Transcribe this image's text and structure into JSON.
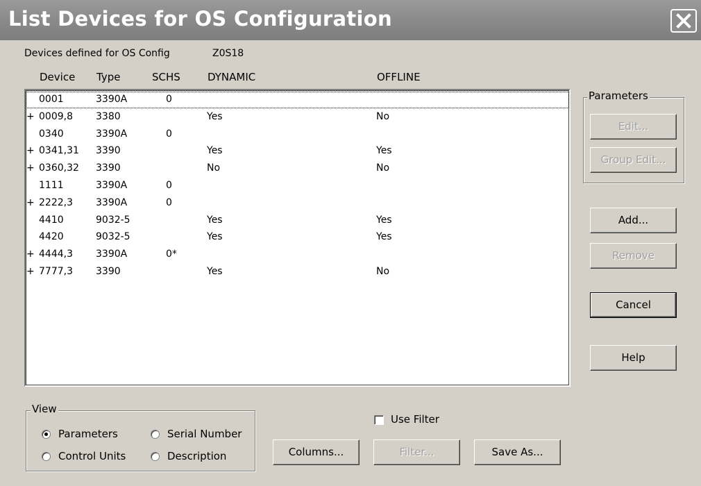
{
  "window": {
    "title": "List Devices for OS Configuration"
  },
  "header": {
    "label": "Devices defined for OS Config",
    "config_id": "Z0S18"
  },
  "columns": [
    "Device",
    "Type",
    "SCHS",
    "DYNAMIC",
    "OFFLINE"
  ],
  "rows": [
    {
      "prefix": "",
      "device": "0001",
      "type": "3390A",
      "schs": "0",
      "dynamic": "",
      "offline": ""
    },
    {
      "prefix": "+",
      "device": "0009,8",
      "type": "3380",
      "schs": "",
      "dynamic": "Yes",
      "offline": "No"
    },
    {
      "prefix": "",
      "device": "0340",
      "type": "3390A",
      "schs": "0",
      "dynamic": "",
      "offline": ""
    },
    {
      "prefix": "+",
      "device": "0341,31",
      "type": "3390",
      "schs": "",
      "dynamic": "Yes",
      "offline": "Yes"
    },
    {
      "prefix": "+",
      "device": "0360,32",
      "type": "3390",
      "schs": "",
      "dynamic": "No",
      "offline": "No"
    },
    {
      "prefix": "",
      "device": "1111",
      "type": "3390A",
      "schs": "0",
      "dynamic": "",
      "offline": ""
    },
    {
      "prefix": "+",
      "device": "2222,3",
      "type": "3390A",
      "schs": "0",
      "dynamic": "",
      "offline": ""
    },
    {
      "prefix": "",
      "device": "4410",
      "type": "9032-5",
      "schs": "",
      "dynamic": "Yes",
      "offline": "Yes"
    },
    {
      "prefix": "",
      "device": "4420",
      "type": "9032-5",
      "schs": "",
      "dynamic": "Yes",
      "offline": "Yes"
    },
    {
      "prefix": "+",
      "device": "4444,3",
      "type": "3390A",
      "schs": "0*",
      "dynamic": "",
      "offline": ""
    },
    {
      "prefix": "+",
      "device": "7777,3",
      "type": "3390",
      "schs": "",
      "dynamic": "Yes",
      "offline": "No"
    }
  ],
  "parameters_group": {
    "title": "Parameters",
    "edit": "Edit...",
    "group_edit": "Group Edit..."
  },
  "buttons": {
    "add": "Add...",
    "remove": "Remove",
    "cancel": "Cancel",
    "help": "Help",
    "columns": "Columns...",
    "filter": "Filter...",
    "save_as": "Save As..."
  },
  "view_group": {
    "title": "View",
    "options": [
      "Parameters",
      "Serial Number",
      "Control Units",
      "Description"
    ],
    "selected": "Parameters"
  },
  "use_filter": {
    "label": "Use Filter",
    "checked": false
  }
}
